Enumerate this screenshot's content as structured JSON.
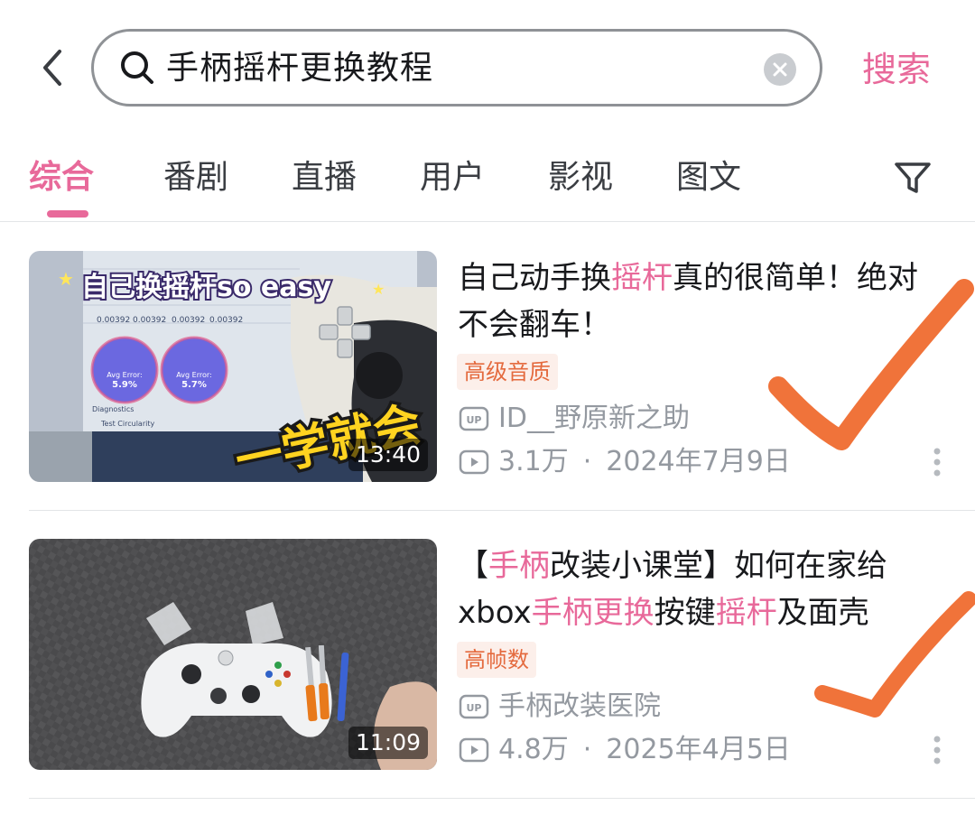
{
  "search": {
    "query": "手柄摇杆更换教程",
    "submit_label": "搜索"
  },
  "tabs": [
    {
      "label": "综合"
    },
    {
      "label": "番剧"
    },
    {
      "label": "直播"
    },
    {
      "label": "用户"
    },
    {
      "label": "影视"
    },
    {
      "label": "图文"
    }
  ],
  "colors": {
    "accent": "#e8699a",
    "checkmark": "#f0733a"
  },
  "results": [
    {
      "title_parts": [
        "自己动手换",
        "摇杆",
        "真的很简单！绝对不会翻车！"
      ],
      "tag": "高级音质",
      "uploader": "ID__野原新之助",
      "views": "3.1万",
      "date": "2024年7月9日",
      "duration": "13:40",
      "thumb_text": {
        "caption": "自己换摇杆so easy",
        "sticker": "一学就会",
        "err_label": "Avg Error:",
        "err1": "5.9%",
        "err2": "5.7%",
        "circularity": "Test Circularity",
        "axis_value": "0.00392",
        "diagnostics": "Diagnostics"
      }
    },
    {
      "title_parts": [
        "【",
        "手柄",
        "改装小课堂】如何在家给xbox",
        "手柄更换",
        "按键",
        "摇杆",
        "及面壳"
      ],
      "tag": "高帧数",
      "uploader": "手柄改装医院",
      "views": "4.8万",
      "date": "2025年4月5日",
      "duration": "11:09"
    }
  ],
  "sep": "·",
  "icons": {
    "back": "chevron-left-icon",
    "search": "search-icon",
    "clear": "close-icon",
    "filter": "filter-icon",
    "uploader": "up-icon",
    "views": "play-icon",
    "more": "more-vertical-icon"
  }
}
